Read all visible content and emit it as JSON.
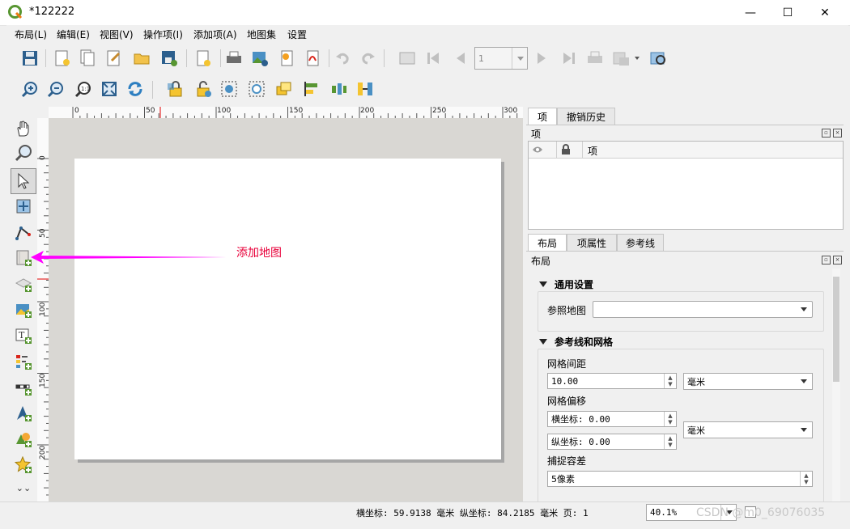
{
  "window": {
    "title": "*122222",
    "minimize_label": "—",
    "maximize_label": "☐",
    "close_label": "✕"
  },
  "menu": {
    "items": [
      "布局(L)",
      "编辑(E)",
      "视图(V)",
      "操作项(I)",
      "添加项(A)",
      "地图集",
      "设置"
    ]
  },
  "atlas": {
    "page_value": "1"
  },
  "ruler": {
    "h_labels": [
      "0",
      "50",
      "100",
      "150",
      "200",
      "250",
      "300"
    ],
    "v_labels": [
      "0",
      "50",
      "100",
      "150",
      "200"
    ]
  },
  "annotation": {
    "text": "添加地图",
    "color": "#ff00ff",
    "text_color": "#e8003a"
  },
  "items_panel": {
    "tabs": [
      "项",
      "撤销历史"
    ],
    "header": "项",
    "col_item": "项"
  },
  "layout_panel": {
    "tabs": [
      "布局",
      "项属性",
      "参考线"
    ],
    "header": "布局",
    "general": {
      "title": "通用设置",
      "ref_map_label": "参照地图",
      "ref_map_value": ""
    },
    "guides": {
      "title": "参考线和网格",
      "grid_spacing_label": "网格间距",
      "grid_spacing_value": "10.00",
      "grid_spacing_unit": "毫米",
      "grid_offset_label": "网格偏移",
      "x_offset": "横坐标: 0.00",
      "y_offset": "纵坐标: 0.00",
      "offset_unit": "毫米",
      "snap_label": "捕捉容差",
      "snap_value": "5像素"
    }
  },
  "status": {
    "coords": "横坐标: 59.9138 毫米 纵坐标: 84.2185 毫米 页: 1",
    "zoom": "40.1%",
    "watermark": "CSDN @m0_69076035"
  },
  "colors": {
    "accent": "#589632",
    "ruler_marker": "#e00000"
  }
}
